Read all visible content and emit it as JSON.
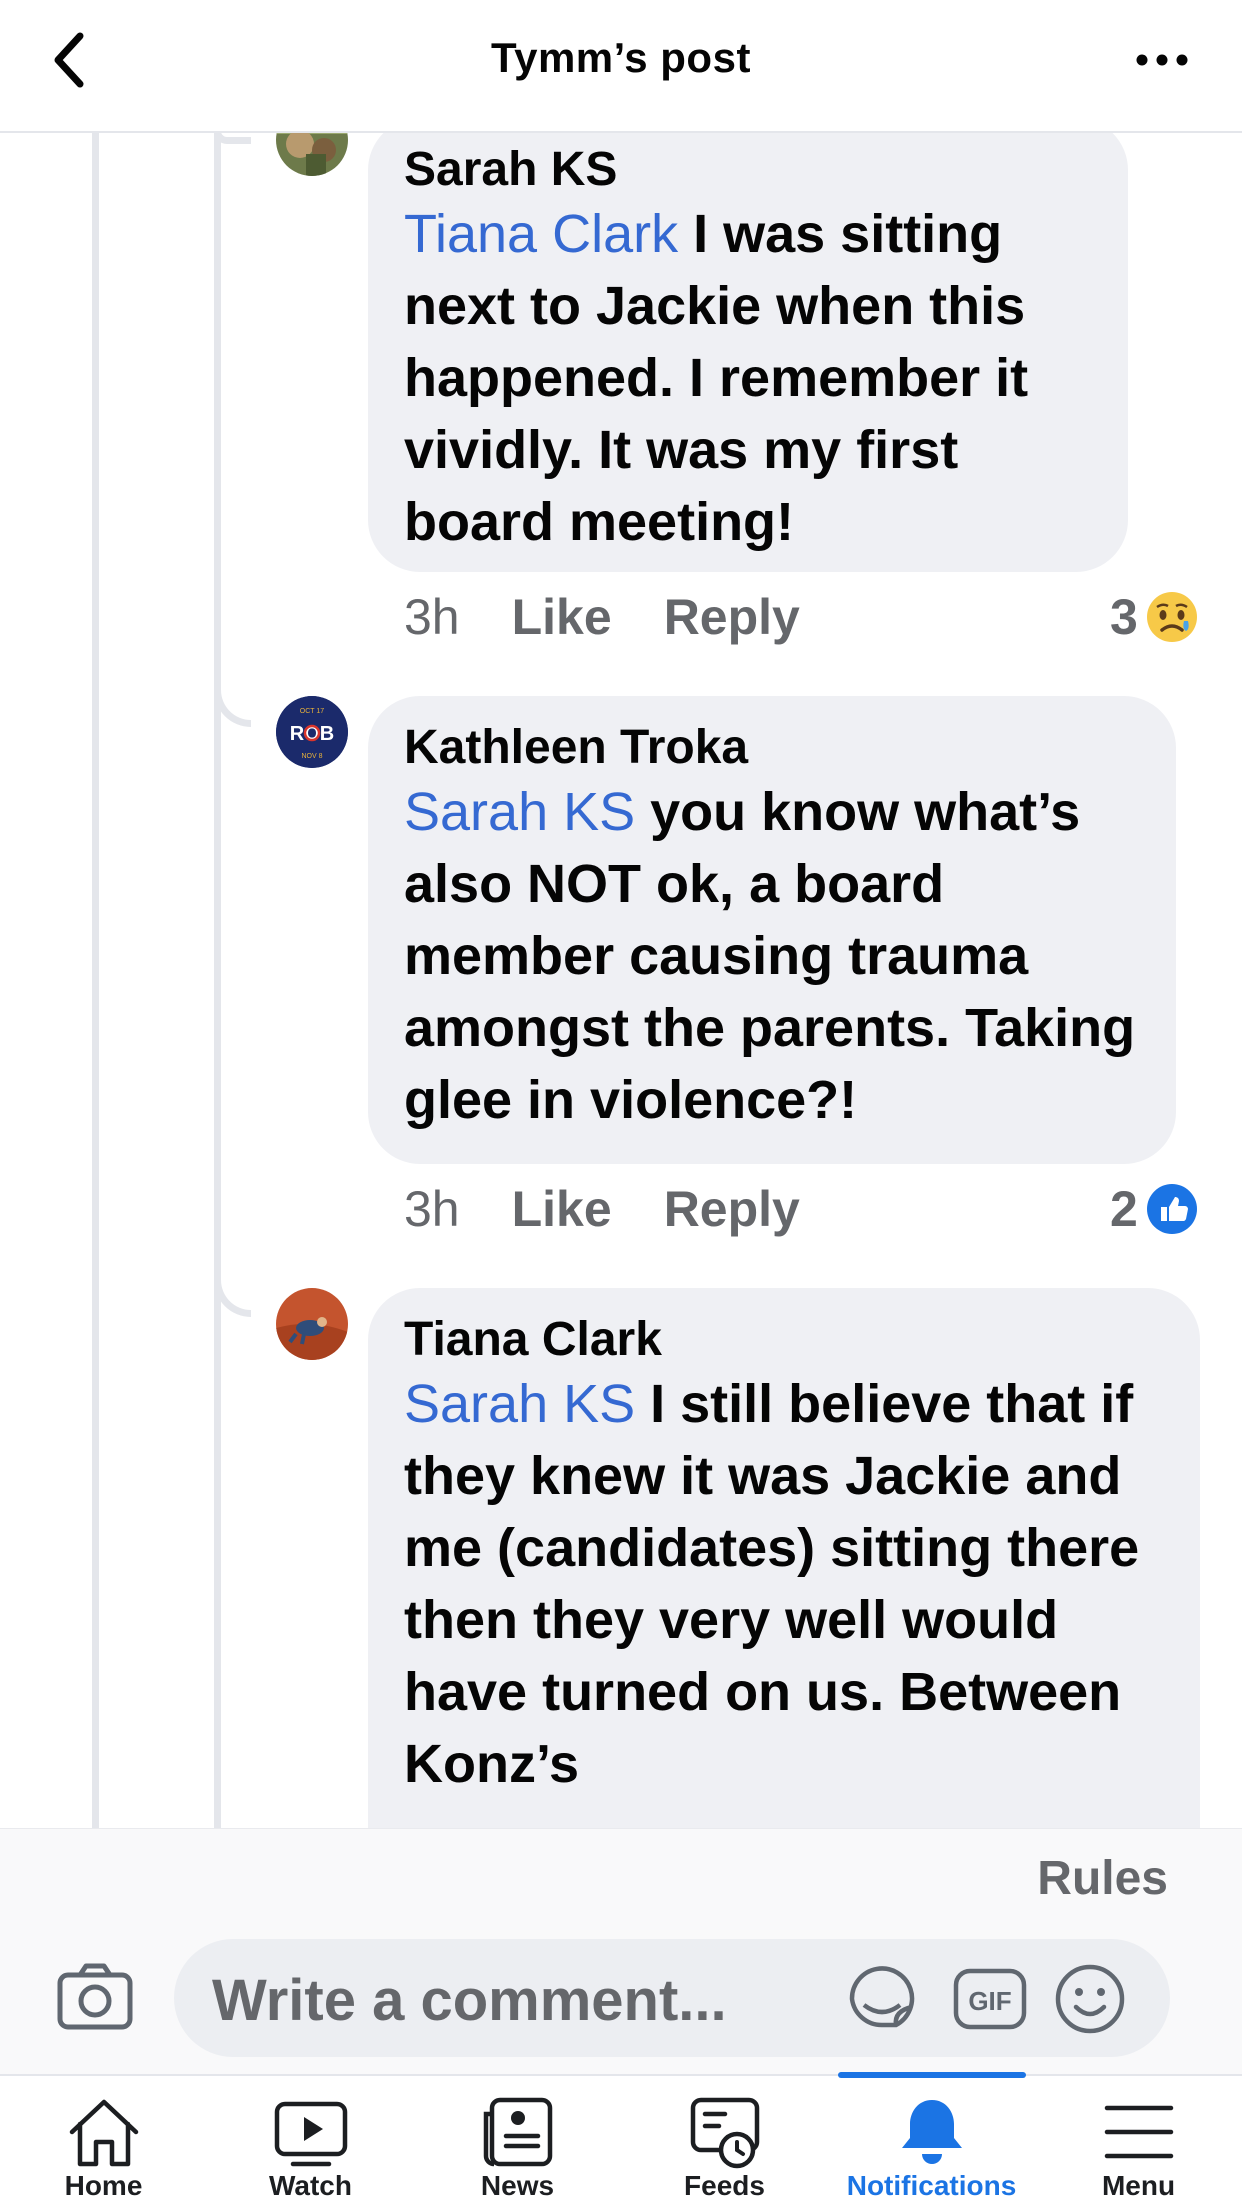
{
  "header": {
    "title": "Tymm’s post"
  },
  "comments": [
    {
      "author": "Sarah KS",
      "mention": "Tiana Clark",
      "text": " I was sitting next to Jackie when this happened. I remember it vividly. It was my first board meeting!",
      "time": "3h",
      "like_label": "Like",
      "reply_label": "Reply",
      "reaction_count": "3",
      "reaction_type": "sad"
    },
    {
      "author": "Kathleen Troka",
      "mention": "Sarah KS",
      "text": " you know what’s also NOT ok, a board member causing trauma amongst the parents. Taking glee in violence?!",
      "time": "3h",
      "like_label": "Like",
      "reply_label": "Reply",
      "reaction_count": "2",
      "reaction_type": "like",
      "avatar_text": "ROB",
      "avatar_top": "OCT 17",
      "avatar_bottom": "NOV 8"
    },
    {
      "author": "Tiana Clark",
      "mention": "Sarah KS",
      "text": " I still believe that if they knew it was Jackie and me (candidates) sitting there then they very well would have turned on us. Between Konz’s"
    }
  ],
  "composer": {
    "rules_label": "Rules",
    "placeholder": "Write a comment..."
  },
  "tabs": [
    {
      "label": "Home"
    },
    {
      "label": "Watch"
    },
    {
      "label": "News"
    },
    {
      "label": "Feeds"
    },
    {
      "label": "Notifications"
    },
    {
      "label": "Menu"
    }
  ],
  "colors": {
    "accent": "#1b74e4",
    "mention": "#3569d2",
    "bubble": "#eff0f4"
  }
}
